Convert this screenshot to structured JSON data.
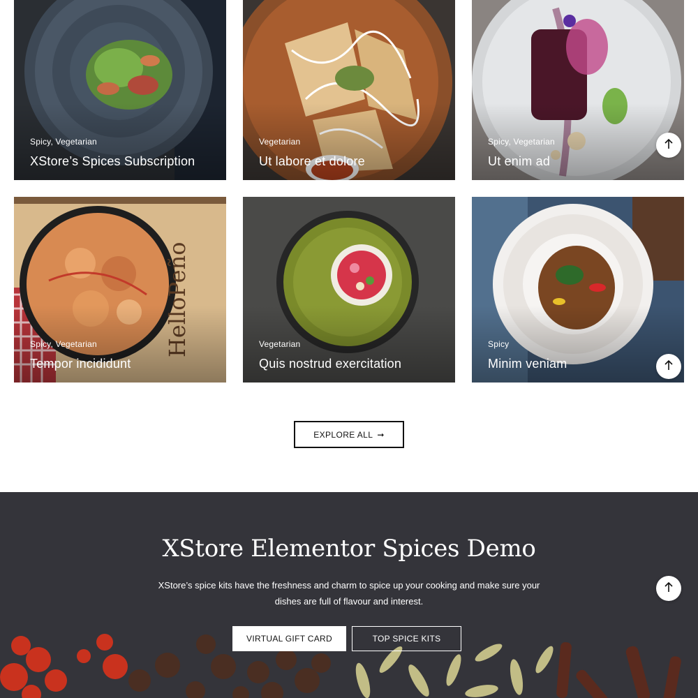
{
  "cards": [
    {
      "tags": "Spicy, Vegetarian",
      "title": "XStore’s Spices Subscription"
    },
    {
      "tags": "Vegetarian",
      "title": "Ut labore et dolore"
    },
    {
      "tags": "Spicy, Vegetarian",
      "title": "Ut enim ad"
    },
    {
      "tags": "Spicy, Vegetarian",
      "title": "Tempor incididunt"
    },
    {
      "tags": "Vegetarian",
      "title": "Quis nostrud exercitation"
    },
    {
      "tags": "Spicy",
      "title": "Minim veniam"
    }
  ],
  "explore": {
    "label": "EXPLORE ALL",
    "arrow": "➞"
  },
  "banner": {
    "title": "XStore Elementor Spices Demo",
    "text": "XStore’s spice kits have the freshness and charm to spice up your cooking and make sure your dishes are full of flavour and interest.",
    "gift_label": "VIRTUAL GIFT CARD",
    "kits_label": "TOP SPICE KITS"
  },
  "icons": {
    "scroll_top": "arrow-up-icon"
  },
  "colors": {
    "banner_bg": "#34343a",
    "text_dark": "#111111"
  }
}
